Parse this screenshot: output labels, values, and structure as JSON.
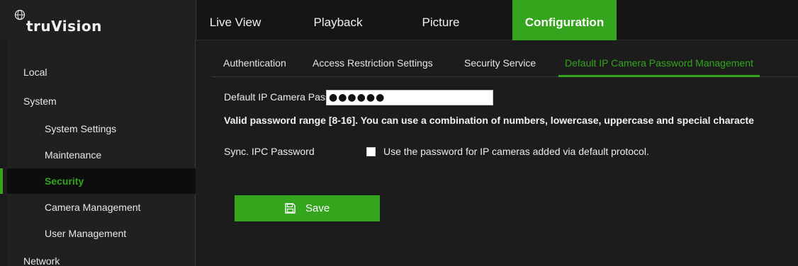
{
  "brand": {
    "name": "truVision",
    "logo_icon": "tv-globe-icon"
  },
  "nav": [
    {
      "label": "Live View",
      "active": false
    },
    {
      "label": "Playback",
      "active": false
    },
    {
      "label": "Picture",
      "active": false
    },
    {
      "label": "Configuration",
      "active": true
    }
  ],
  "sidebar": {
    "items": [
      {
        "label": "Local",
        "level": 0,
        "active": false
      },
      {
        "label": "System",
        "level": 0,
        "active": false
      },
      {
        "label": "System Settings",
        "level": 1,
        "active": false
      },
      {
        "label": "Maintenance",
        "level": 1,
        "active": false
      },
      {
        "label": "Security",
        "level": 1,
        "active": true
      },
      {
        "label": "Camera Management",
        "level": 1,
        "active": false
      },
      {
        "label": "User Management",
        "level": 1,
        "active": false
      },
      {
        "label": "Network",
        "level": 0,
        "active": false
      }
    ]
  },
  "tabs": [
    {
      "label": "Authentication",
      "active": false
    },
    {
      "label": "Access Restriction Settings",
      "active": false
    },
    {
      "label": "Security Service",
      "active": false
    },
    {
      "label": "Default IP Camera Password Management",
      "active": true
    }
  ],
  "form": {
    "password_label": "Default IP Camera Passw...",
    "password_value": "●●●●●●",
    "hint": "Valid password range [8-16]. You can use a combination of numbers, lowercase, uppercase and special characte",
    "sync_label": "Sync. IPC Password",
    "sync_checked": false,
    "sync_text": "Use the password for IP cameras added via default protocol."
  },
  "save_button": {
    "label": "Save",
    "icon": "save-icon"
  },
  "colors": {
    "accent": "#34a51d",
    "background": "#1c1c1c",
    "header": "#151515",
    "sidebar": "#202020"
  }
}
